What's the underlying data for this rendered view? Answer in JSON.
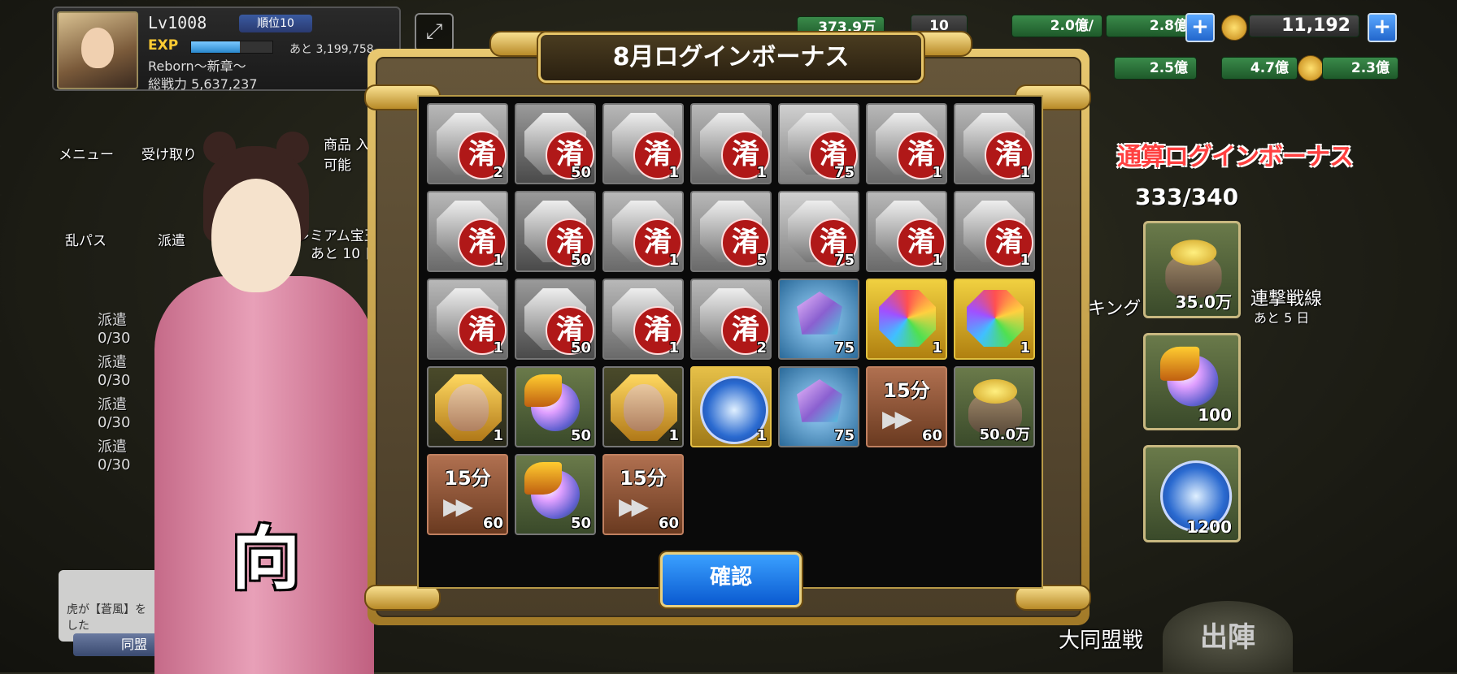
{
  "hud": {
    "level": "Lv1008",
    "rank_badge": "順位10",
    "exp_label": "EXP",
    "exp_fraction": 0.6,
    "exp_remaining": "あと 3,199,758",
    "player_name": "Reborn～新章～",
    "total_power": "総戦力 5,637,237",
    "res_1": "373.9万",
    "res_2_count": "10",
    "res_3": "2.0億/",
    "res_4": "2.8億",
    "res_5": "2.5億",
    "res_6": "4.7億",
    "res_7": "2.3億",
    "gold_count": "11,192",
    "expand_icon": "expand-icon"
  },
  "left_menu": {
    "menu": "メニュー",
    "receive": "受け取り",
    "shop": "商品 入可能",
    "ran_pass": "乱パス",
    "dispatch": "派遣",
    "premium": "レミアム宝玉",
    "premium_days": "あと 10 日",
    "dispatch_rows": [
      {
        "label": "派遣",
        "value": "0/30"
      },
      {
        "label": "派遣",
        "value": "0/30"
      },
      {
        "label": "派遣",
        "value": "0/30"
      },
      {
        "label": "派遣",
        "value": "0/30"
      }
    ],
    "chat_line1": "虎が【蒼風】を",
    "chat_line2": "した",
    "alliance": "同盟"
  },
  "character": {
    "emblem": "向"
  },
  "modal": {
    "title": "8月ログインボーナス",
    "confirm": "確認",
    "seal_char": "淆",
    "timer_label": "15分",
    "items": [
      {
        "type": "token",
        "count": "2"
      },
      {
        "type": "dragon",
        "count": "50"
      },
      {
        "type": "token",
        "count": "1"
      },
      {
        "type": "token",
        "count": "1"
      },
      {
        "type": "token2",
        "count": "75"
      },
      {
        "type": "token",
        "count": "1"
      },
      {
        "type": "token",
        "count": "1"
      },
      {
        "type": "token",
        "count": "1"
      },
      {
        "type": "dragon",
        "count": "50"
      },
      {
        "type": "token",
        "count": "1"
      },
      {
        "type": "token",
        "count": "5"
      },
      {
        "type": "token2",
        "count": "75"
      },
      {
        "type": "token",
        "count": "1"
      },
      {
        "type": "token",
        "count": "1"
      },
      {
        "type": "token",
        "count": "1"
      },
      {
        "type": "dragon",
        "count": "50"
      },
      {
        "type": "token",
        "count": "1"
      },
      {
        "type": "token",
        "count": "2"
      },
      {
        "type": "crystal",
        "count": "75"
      },
      {
        "type": "rainbow",
        "count": "1"
      },
      {
        "type": "rainbow",
        "count": "1"
      },
      {
        "type": "portrait",
        "count": "1"
      },
      {
        "type": "orb",
        "count": "50"
      },
      {
        "type": "portrait",
        "count": "1"
      },
      {
        "type": "blue",
        "count": "1"
      },
      {
        "type": "crystal",
        "count": "75"
      },
      {
        "type": "timer",
        "count": "60"
      },
      {
        "type": "pot",
        "count": "50.0万"
      },
      {
        "type": "timer",
        "count": "60"
      },
      {
        "type": "orb",
        "count": "50"
      },
      {
        "type": "timer",
        "count": "60"
      }
    ]
  },
  "cumulative": {
    "title": "通算ログインボーナス",
    "progress": "333/340",
    "rewards": [
      {
        "type": "pot",
        "count": "35.0万"
      },
      {
        "type": "orb",
        "count": "100"
      },
      {
        "type": "blue",
        "count": "1200"
      }
    ]
  },
  "bottom": {
    "deploy": "出陣",
    "alliance_battle": "大同盟戦",
    "ranking": "キング",
    "event": "連撃戦線",
    "event_days": "あと 5 日"
  }
}
